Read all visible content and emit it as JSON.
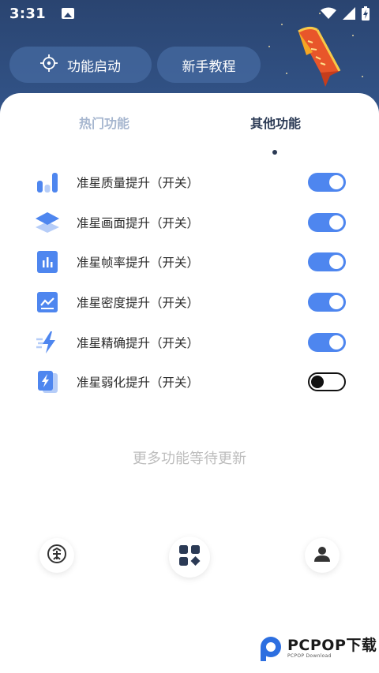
{
  "status_bar": {
    "time": "3:31",
    "icons": [
      "image-icon",
      "wifi-icon",
      "signal-icon",
      "battery-charging-icon"
    ]
  },
  "header": {
    "start_button": {
      "label": "功能启动",
      "icon": "crosshair-icon"
    },
    "tutorial_button": {
      "label": "新手教程"
    },
    "ribbon_badge": {
      "icon": "lucky-ribbon-icon"
    }
  },
  "tabs": [
    {
      "label": "热门功能",
      "active": false
    },
    {
      "label": "其他功能",
      "active": true
    }
  ],
  "features": [
    {
      "label": "准星质量提升（开关）",
      "icon": "bar-chart-icon",
      "enabled": true
    },
    {
      "label": "准星画面提升（开关）",
      "icon": "layers-icon",
      "enabled": true
    },
    {
      "label": "准星帧率提升（开关）",
      "icon": "document-chart-icon",
      "enabled": true
    },
    {
      "label": "准星密度提升（开关）",
      "icon": "trend-line-icon",
      "enabled": true
    },
    {
      "label": "准星精确提升（开关）",
      "icon": "lightning-icon",
      "enabled": true
    },
    {
      "label": "准星弱化提升（开关）",
      "icon": "phone-bolt-icon",
      "enabled": false
    }
  ],
  "more_text": "更多功能等待更新",
  "bottom_nav": {
    "free": {
      "icon": "free-badge-icon"
    },
    "apps": {
      "icon": "apps-grid-icon"
    },
    "user": {
      "icon": "user-icon"
    }
  },
  "watermark": {
    "main": "PCPOP下载",
    "sub": "PCPOP Download"
  },
  "colors": {
    "header_bg": "#2a4470",
    "accent": "#4e86ef",
    "tab_active": "#2b3a55",
    "tab_inactive": "#a6b6cf",
    "muted_text": "#bdbdbd"
  }
}
